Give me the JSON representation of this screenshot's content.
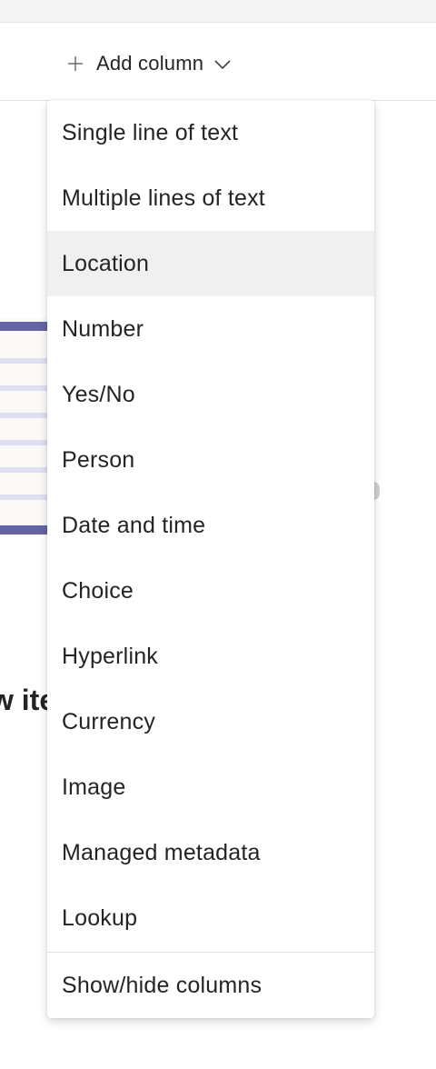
{
  "header": {
    "add_column_label": "Add column",
    "plus_icon": "plus-icon",
    "chevron_icon": "chevron-down-icon"
  },
  "background": {
    "partial_title": "w ite"
  },
  "menu": {
    "items": [
      {
        "label": "Single line of text"
      },
      {
        "label": "Multiple lines of text"
      },
      {
        "label": "Location"
      },
      {
        "label": "Number"
      },
      {
        "label": "Yes/No"
      },
      {
        "label": "Person"
      },
      {
        "label": "Date and time"
      },
      {
        "label": "Choice"
      },
      {
        "label": "Hyperlink"
      },
      {
        "label": "Currency"
      },
      {
        "label": "Image"
      },
      {
        "label": "Managed metadata"
      },
      {
        "label": "Lookup"
      }
    ],
    "footer_label": "Show/hide columns",
    "highlighted_item": "Location"
  },
  "colors": {
    "accent": "#6264a7",
    "accent_light": "#dfdff2",
    "hover_bg": "#f0f0f0",
    "text": "#242424"
  }
}
